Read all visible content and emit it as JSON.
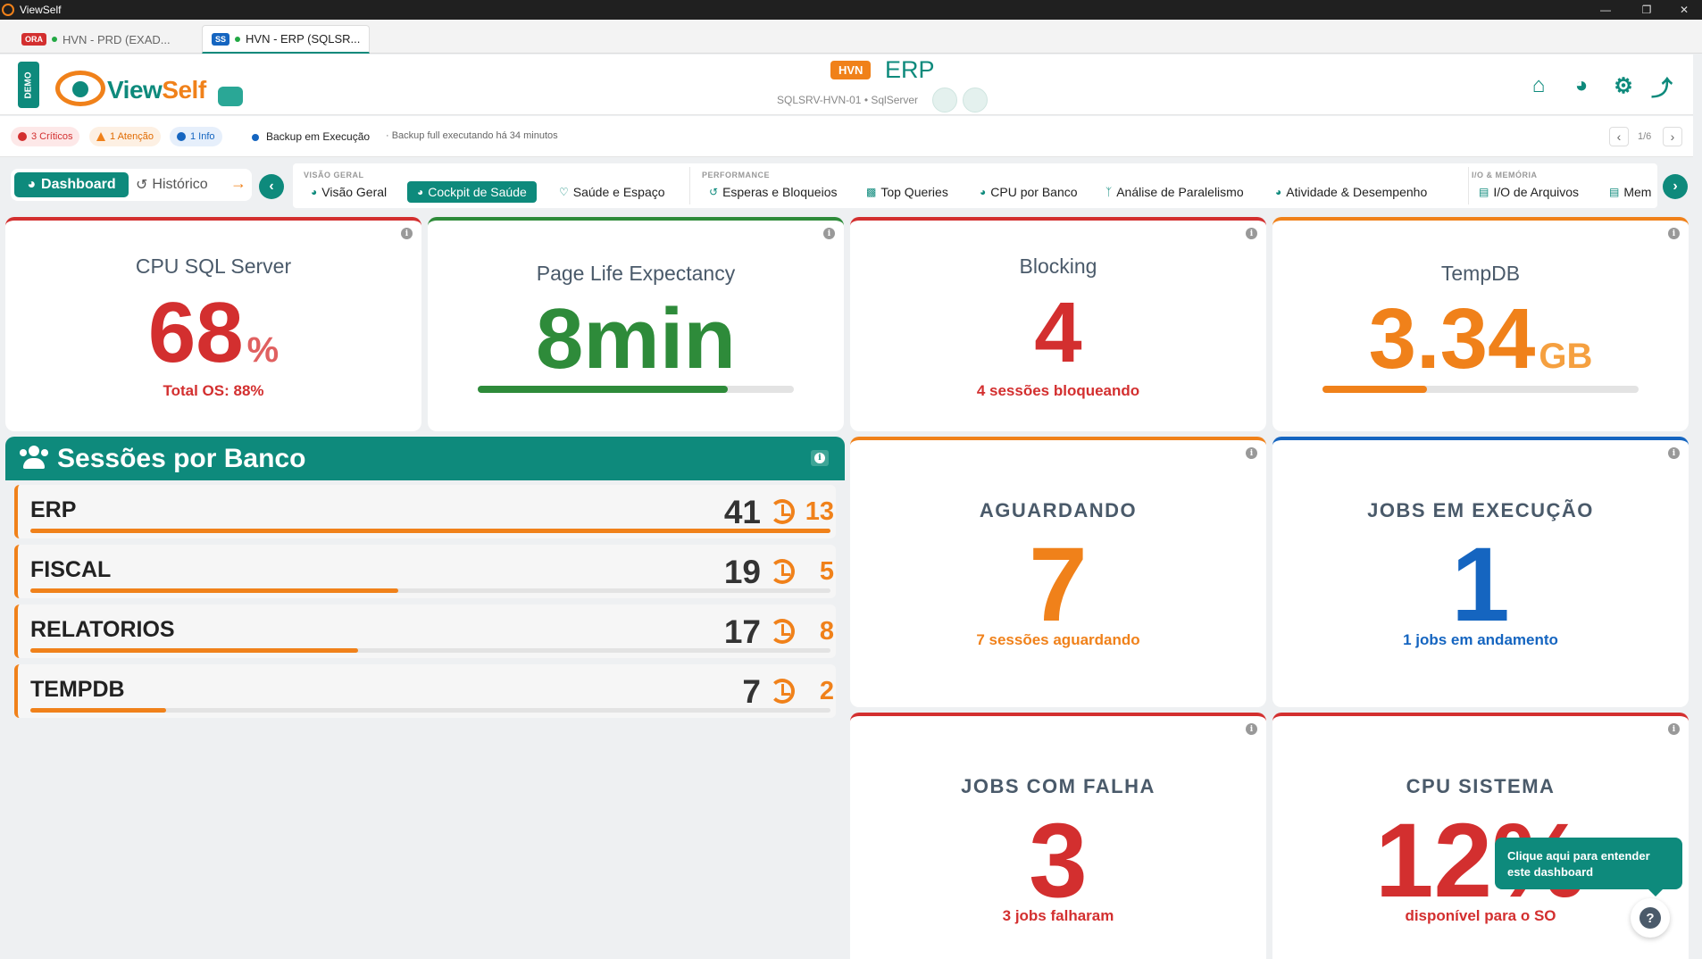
{
  "window": {
    "title": "ViewSelf"
  },
  "tabs": [
    {
      "badge": "ORA",
      "badge_color": "#d32f2f",
      "label": "HVN - PRD (EXAD..."
    },
    {
      "badge": "SS",
      "badge_color": "#1565c0",
      "label": "HVN - ERP (SQLSR..."
    }
  ],
  "header": {
    "demo": "DEMO",
    "logo": "ViewSelf",
    "env_badge": "HVN",
    "title": "ERP",
    "server": "SQLSRV-HVN-01 • SqlServer"
  },
  "alerts": {
    "critical": "3 Críticos",
    "warning": "1 Atenção",
    "info": "1 Info",
    "backup_title": "Backup em Execução",
    "backup_desc": "· Backup full executando há 34 minutos",
    "pager": "1/6"
  },
  "nav": {
    "dashboard": "Dashboard",
    "historico": "Histórico",
    "sections": {
      "visao": "VISÃO GERAL",
      "performance": "PERFORMANCE",
      "io": "I/O & MEMÓRIA"
    },
    "items": [
      "Visão Geral",
      "Cockpit de Saúde",
      "Saúde e Espaço",
      "Esperas e Bloqueios",
      "Top Queries",
      "CPU por Banco",
      "Análise de Paralelismo",
      "Atividade & Desempenho",
      "I/O de Arquivos",
      "Mem"
    ]
  },
  "kpis": {
    "cpu": {
      "title": "CPU SQL Server",
      "value": "68",
      "unit": "%",
      "sub": "Total OS: 88%",
      "color": "#d32f2f"
    },
    "ple": {
      "title": "Page Life Expectancy",
      "value": "8min",
      "progress": 0.79,
      "color": "#2e8b3a"
    },
    "blocking": {
      "title": "Blocking",
      "value": "4",
      "sub": "4 sessões bloqueando",
      "color": "#d32f2f"
    },
    "tempdb": {
      "title": "TempDB",
      "value": "3.34",
      "unit": "GB",
      "progress": 0.33,
      "color": "#f0811a"
    },
    "aguardando": {
      "title": "AGUARDANDO",
      "value": "7",
      "sub": "7 sessões aguardando",
      "color": "#f0811a"
    },
    "jobs_exec": {
      "title": "JOBS EM EXECUÇÃO",
      "value": "1",
      "sub": "1 jobs em andamento",
      "color": "#1565c0"
    },
    "jobs_falha": {
      "title": "JOBS COM FALHA",
      "value": "3",
      "sub": "3 jobs falharam",
      "color": "#d32f2f"
    },
    "cpu_sistema": {
      "title": "CPU SISTEMA",
      "value": "12%",
      "sub": "disponível para o SO",
      "color": "#d32f2f"
    }
  },
  "sessions": {
    "title": "Sessões por Banco",
    "rows": [
      {
        "db": "ERP",
        "count": "41",
        "waiting": "13",
        "ratio": 1.0
      },
      {
        "db": "FISCAL",
        "count": "19",
        "waiting": "5",
        "ratio": 0.46
      },
      {
        "db": "RELATORIOS",
        "count": "17",
        "waiting": "8",
        "ratio": 0.41
      },
      {
        "db": "TEMPDB",
        "count": "7",
        "waiting": "2",
        "ratio": 0.17
      }
    ]
  },
  "help": {
    "tooltip": "Clique aqui para entender este dashboard",
    "icon": "?"
  }
}
